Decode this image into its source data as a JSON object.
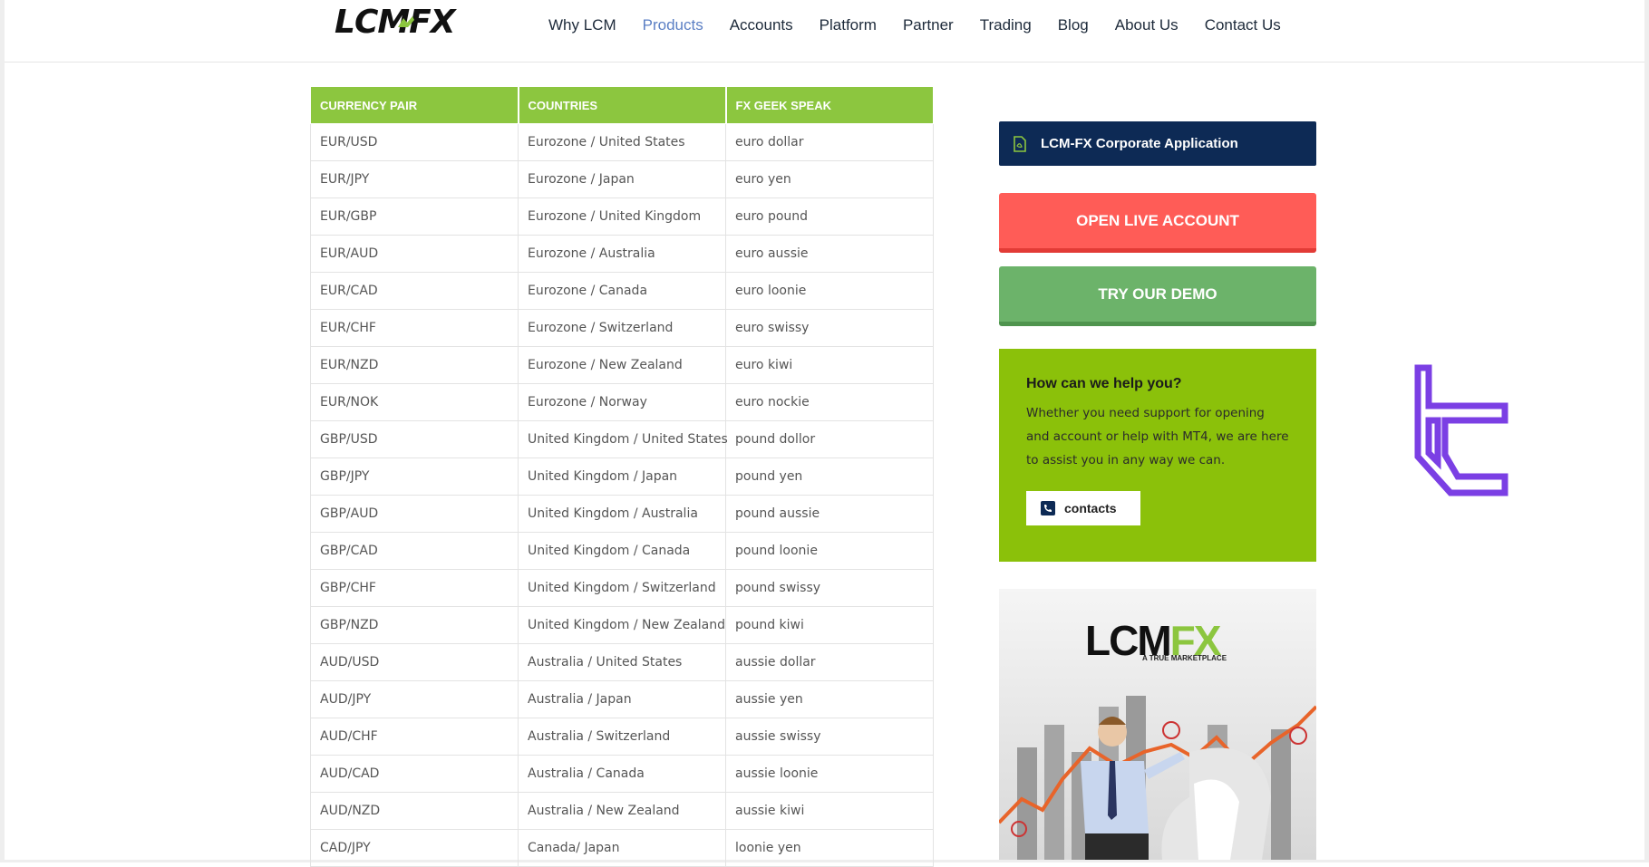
{
  "header": {
    "logo_text": "LCMFX",
    "nav": [
      {
        "label": "Why LCM",
        "active": false
      },
      {
        "label": "Products",
        "active": true
      },
      {
        "label": "Accounts",
        "active": false
      },
      {
        "label": "Platform",
        "active": false
      },
      {
        "label": "Partner",
        "active": false
      },
      {
        "label": "Trading",
        "active": false
      },
      {
        "label": "Blog",
        "active": false
      },
      {
        "label": "About Us",
        "active": false
      },
      {
        "label": "Contact Us",
        "active": false
      }
    ]
  },
  "table": {
    "headers": [
      "CURRENCY PAIR",
      "COUNTRIES",
      "FX GEEK SPEAK"
    ],
    "rows": [
      [
        "EUR/USD",
        "Eurozone / United States",
        "euro dollar"
      ],
      [
        "EUR/JPY",
        "Eurozone / Japan",
        "euro yen"
      ],
      [
        "EUR/GBP",
        "Eurozone / United Kingdom",
        "euro pound"
      ],
      [
        "EUR/AUD",
        "Eurozone / Australia",
        "euro aussie"
      ],
      [
        "EUR/CAD",
        "Eurozone / Canada",
        "euro loonie"
      ],
      [
        "EUR/CHF",
        "Eurozone / Switzerland",
        "euro swissy"
      ],
      [
        "EUR/NZD",
        "Eurozone / New Zealand",
        "euro kiwi"
      ],
      [
        "EUR/NOK",
        "Eurozone / Norway",
        "euro nockie"
      ],
      [
        "GBP/USD",
        "United Kingdom / United States",
        "pound dollor"
      ],
      [
        "GBP/JPY",
        "United Kingdom / Japan",
        "pound yen"
      ],
      [
        "GBP/AUD",
        "United Kingdom / Australia",
        "pound aussie"
      ],
      [
        "GBP/CAD",
        "United Kingdom / Canada",
        "pound loonie"
      ],
      [
        "GBP/CHF",
        "United Kingdom / Switzerland",
        "pound swissy"
      ],
      [
        "GBP/NZD",
        "United Kingdom / New Zealand",
        "pound kiwi"
      ],
      [
        "AUD/USD",
        "Australia / United States",
        "aussie dollar"
      ],
      [
        "AUD/JPY",
        "Australia / Japan",
        "aussie yen"
      ],
      [
        "AUD/CHF",
        "Australia / Switzerland",
        "aussie swissy"
      ],
      [
        "AUD/CAD",
        "Australia / Canada",
        "aussie loonie"
      ],
      [
        "AUD/NZD",
        "Australia / New Zealand",
        "aussie kiwi"
      ],
      [
        "CAD/JPY",
        "Canada/ Japan",
        "loonie yen"
      ]
    ]
  },
  "sidebar": {
    "corporate_button": "LCM-FX Corporate Application",
    "live_button": "OPEN LIVE ACCOUNT",
    "demo_button": "TRY OUR DEMO",
    "help": {
      "title": "How can we help you?",
      "text": "Whether you need support for opening and account or help with MT4, we are here to assist you in any way we can.",
      "contacts_button": "contacts"
    },
    "banner": {
      "logo_lcm": "LCM",
      "logo_fx": "FX",
      "tagline": "A TRUE MARKETPLACE"
    }
  },
  "colors": {
    "table_header": "#8cc63f",
    "corporate": "#0d2a55",
    "live": "#ff5c57",
    "demo": "#6cb36a",
    "help_box": "#8bc10a",
    "nav_active": "#5b7fc4"
  },
  "icons": {
    "corporate_button": "pdf-document-icon",
    "contacts_button": "phone-icon",
    "side_logo": "tc-brand-logo-icon"
  }
}
